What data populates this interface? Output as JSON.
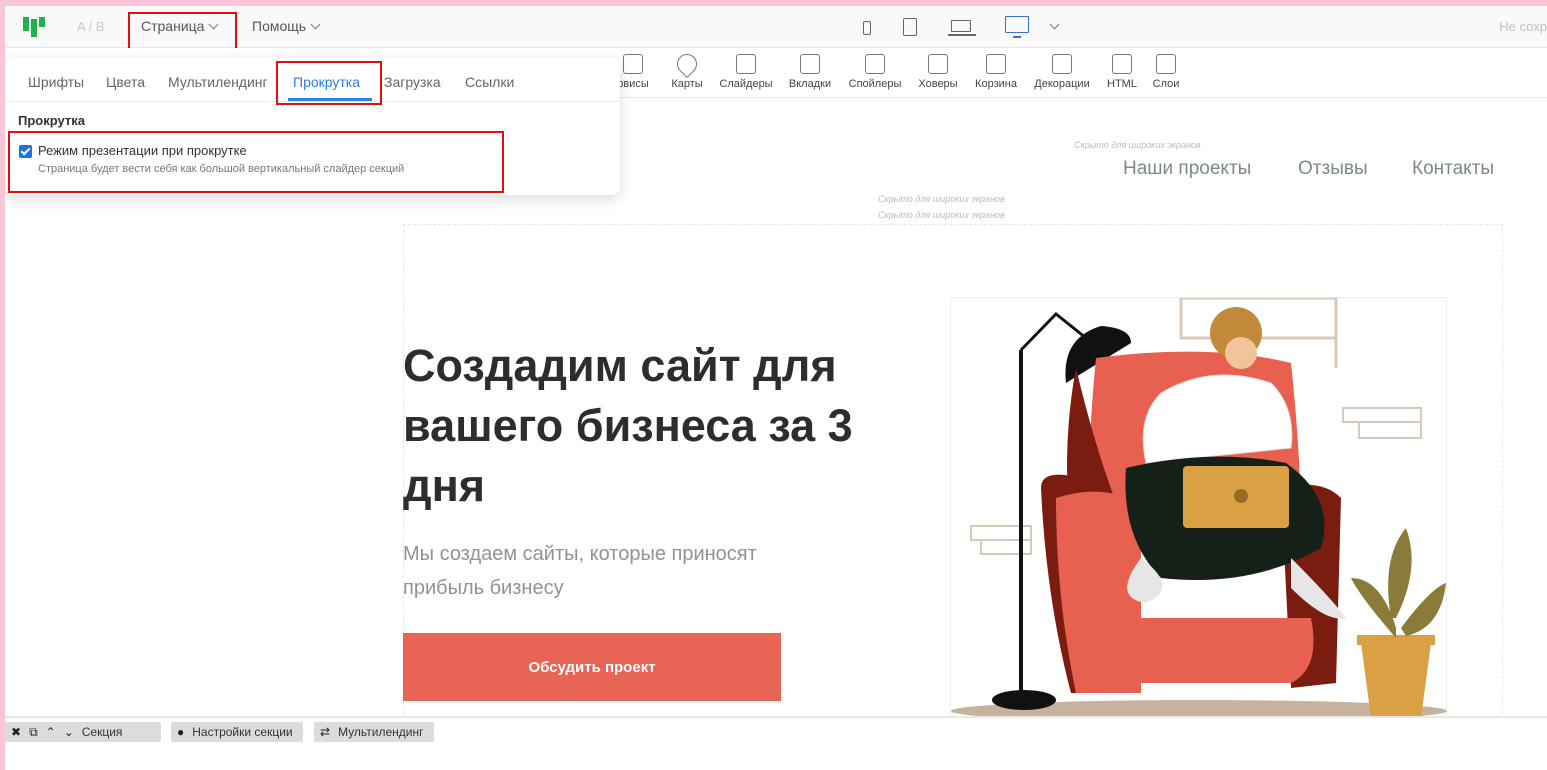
{
  "topbar": {
    "ab_label": "A / B",
    "menu_page": "Страница",
    "menu_help": "Помощь",
    "save_status": "Не сохр"
  },
  "tools": [
    {
      "label": "рвисы",
      "icon": "like-icon"
    },
    {
      "label": "Карты",
      "icon": "map-pin-icon"
    },
    {
      "label": "Слайдеры",
      "icon": "slider-icon"
    },
    {
      "label": "Вкладки",
      "icon": "tabs-icon"
    },
    {
      "label": "Спойлеры",
      "icon": "spoiler-icon"
    },
    {
      "label": "Ховеры",
      "icon": "hover-icon"
    },
    {
      "label": "Корзина",
      "icon": "cart-icon"
    },
    {
      "label": "Декорации",
      "icon": "speech-bubble-icon"
    },
    {
      "label": "HTML",
      "icon": "code-icon"
    },
    {
      "label": "Слои",
      "icon": "layers-icon"
    }
  ],
  "panel": {
    "tabs": [
      "Шрифты",
      "Цвета",
      "Мультилендинг",
      "Прокрутка",
      "Загрузка",
      "Ссылки"
    ],
    "active_tab": "Прокрутка",
    "section_title": "Прокрутка",
    "checkbox_label": "Режим презентации при прокрутке",
    "checkbox_hint": "Страница будет вести себя как большой вертикальный слайдер секций",
    "checkbox_checked": true
  },
  "canvas": {
    "hidden_note": "Скрыто для широких экранов",
    "nav": [
      "Наши проекты",
      "Отзывы",
      "Контакты"
    ],
    "headline": "Создадим сайт для вашего бизнеса за 3 дня",
    "subline": "Мы создаем сайты, которые приносят прибыль бизнесу",
    "cta": "Обсудить проект"
  },
  "bottombar": {
    "section_label": "Секция",
    "section_settings": "Настройки секции",
    "multilanding": "Мультилендинг"
  },
  "colors": {
    "accent": "#2b7de9",
    "brand": "#22b24c",
    "cta": "#e86454",
    "highlight": "#e01010",
    "page_bg": "#f7c6d8"
  }
}
